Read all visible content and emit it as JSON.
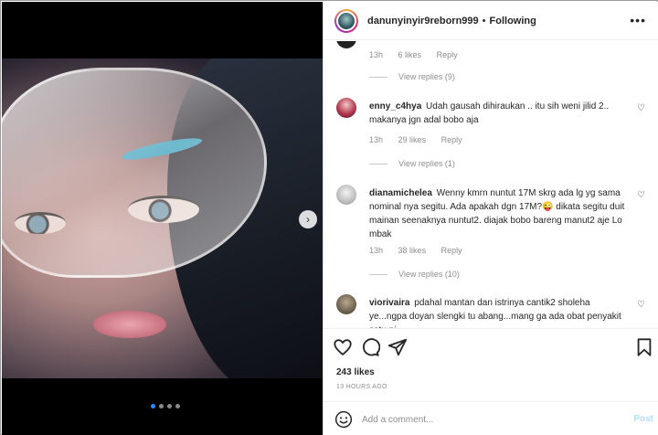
{
  "header": {
    "username": "danunyinyir9reborn999",
    "separator": "•",
    "follow_status": "Following",
    "more_icon": "more-horizontal-icon"
  },
  "comments": [
    {
      "meta": {
        "time": "13h",
        "likes": "6 likes",
        "reply": "Reply"
      },
      "view_replies": "View replies (9)"
    },
    {
      "username": "enny_c4hya",
      "text": "Udah gausah dihiraukan .. itu sih weni jilid 2.. makanya jgn adal bobo aja",
      "meta": {
        "time": "13h",
        "likes": "29 likes",
        "reply": "Reply"
      },
      "view_replies": "View replies (1)"
    },
    {
      "username": "dianamichelea",
      "text": "Wenny kmrn nuntut 17M skrg ada lg yg sama nominal nya segitu. Ada apakah dgn 17M?😜 dikata segitu duit mainan seenaknya nuntut2. diajak bobo bareng manut2 aje Lo mbak",
      "meta": {
        "time": "13h",
        "likes": "38 likes",
        "reply": "Reply"
      },
      "view_replies": "View replies (10)"
    },
    {
      "username": "viorivaira",
      "text": "pdahal mantan dan istrinya cantik2 sholeha ye...ngpa doyan slengki tu abang...mang ga ada obat penyakit satu ni"
    }
  ],
  "actions": {
    "likes": "243 likes",
    "time_ago": "13 HOURS AGO"
  },
  "add_comment": {
    "placeholder": "Add a comment...",
    "post_label": "Post"
  },
  "carousel": {
    "slides": 4,
    "active": 1
  },
  "colors": {
    "link_blue": "#0095f6",
    "post_disabled": "#b2dffc",
    "secondary_text": "#8e8e8e"
  }
}
